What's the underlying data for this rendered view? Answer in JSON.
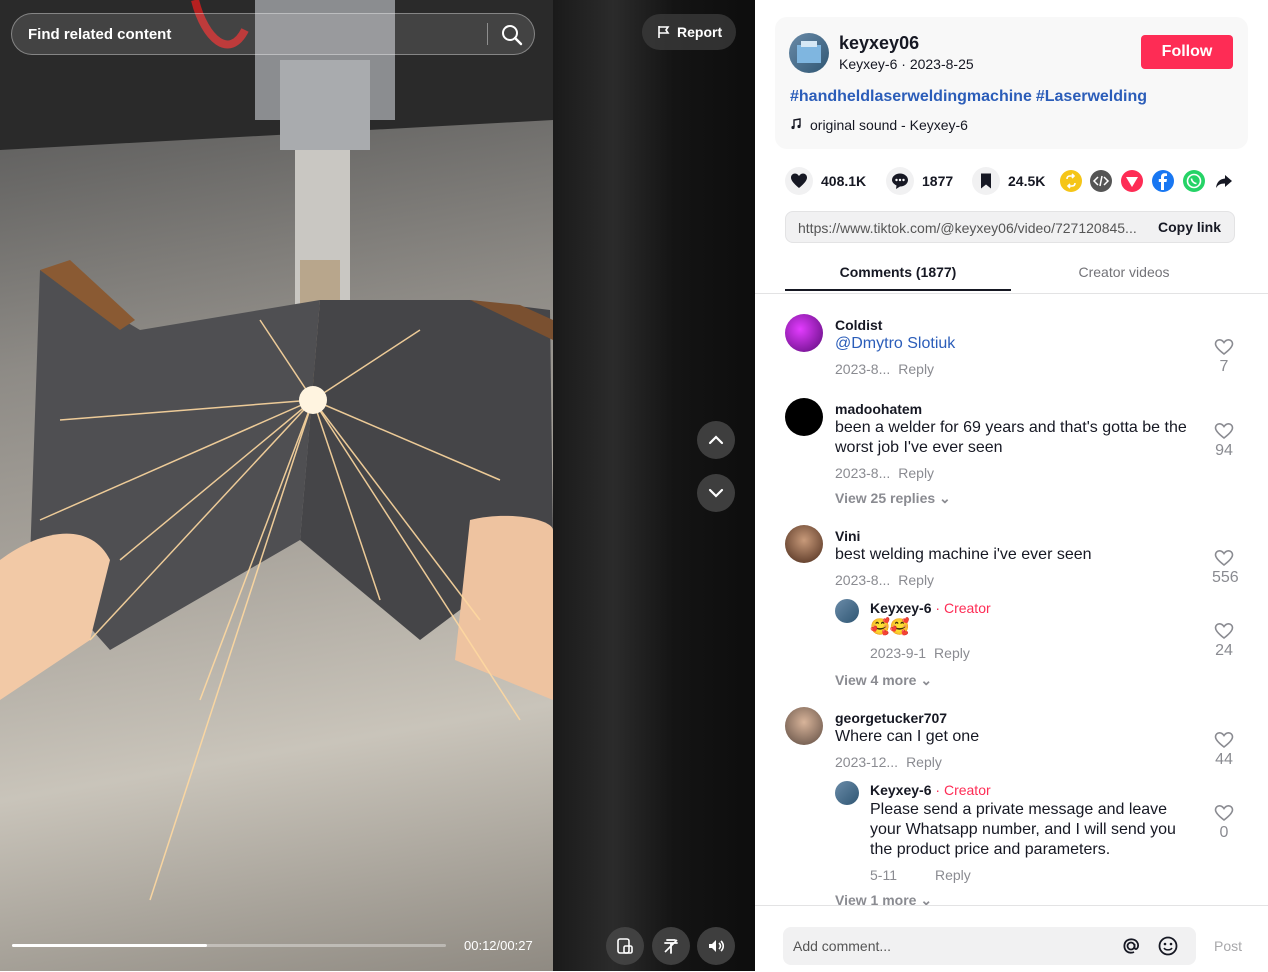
{
  "video": {
    "search_placeholder": "Find related content",
    "report_label": "Report",
    "time": "00:12/00:27",
    "progress_fraction": 0.45
  },
  "author": {
    "username": "keyxey06",
    "nickname": "Keyxey-6",
    "date": "2023-8-25",
    "follow_label": "Follow"
  },
  "description": {
    "hashtags": [
      "#handheldlaserweldingmachine",
      "#Laserwelding"
    ],
    "sound": "original sound - Keyxey-6"
  },
  "stats": {
    "likes": "408.1K",
    "comments": "1877",
    "saves": "24.5K"
  },
  "share": {
    "icons": [
      "repost-icon",
      "embed-icon",
      "send-to-friends-icon",
      "facebook-icon",
      "whatsapp-icon",
      "share-arrow-icon"
    ],
    "colors": {
      "repost": "#f5c518",
      "embed": "#555555",
      "friends": "#fe2c55",
      "facebook": "#1877f2",
      "whatsapp": "#25d366"
    }
  },
  "link": {
    "url": "https://www.tiktok.com/@keyxey06/video/727120845...",
    "copy_label": "Copy link"
  },
  "tabs": {
    "comments": "Comments (1877)",
    "creator_videos": "Creator videos"
  },
  "comments": [
    {
      "user": "Coldist",
      "text": "@Dmytro Slotiuk",
      "date": "2023-8...",
      "reply": "Reply",
      "likes": "7"
    },
    {
      "user": "madoohatem",
      "text": "been a welder for 69 years and that's gotta be the worst job I've ever seen",
      "date": "2023-8...",
      "reply": "Reply",
      "likes": "94",
      "view_replies": "View 25 replies"
    },
    {
      "user": "Vini",
      "text": "best welding machine i've ever seen",
      "date": "2023-8...",
      "reply": "Reply",
      "likes": "556",
      "creator_reply": {
        "user": "Keyxey-6",
        "tag": "Creator",
        "text": "🥰🥰",
        "date": "2023-9-1",
        "reply": "Reply",
        "likes": "24"
      },
      "view_more": "View 4 more"
    },
    {
      "user": "georgetucker707",
      "text": "Where can I get one",
      "date": "2023-12...",
      "reply": "Reply",
      "likes": "44",
      "creator_reply": {
        "user": "Keyxey-6",
        "tag": "Creator",
        "text": "Please send a private message and leave your Whatsapp number, and I will send you the product price and parameters.",
        "date": "5-11",
        "reply": "Reply",
        "likes": "0"
      },
      "view_more": "View 1 more"
    }
  ],
  "composer": {
    "placeholder": "Add comment...",
    "post_label": "Post"
  }
}
